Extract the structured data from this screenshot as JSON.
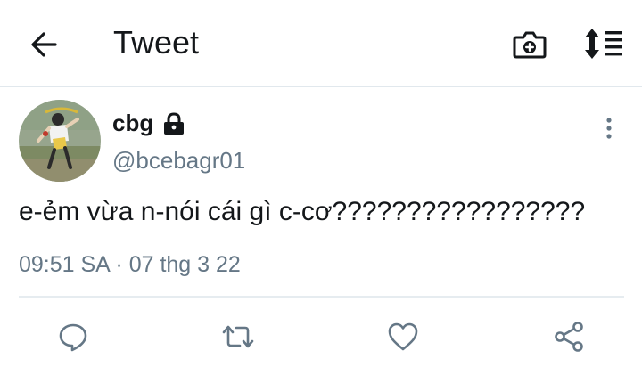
{
  "header": {
    "title": "Tweet",
    "icons": {
      "back": "arrow-left-icon",
      "camera": "camera-plus-icon",
      "sort": "sort-list-icon"
    }
  },
  "tweet": {
    "author": {
      "name": "cbg",
      "handle": "@bcebagr01",
      "protected": true
    },
    "text": "e-ẻm vừa n-nói cái gì c-cơ?????????????????",
    "timestamp": "09:51 SA · 07 thg 3 22"
  },
  "actions": {
    "icons": [
      "reply-icon",
      "retweet-icon",
      "like-icon",
      "share-icon"
    ],
    "icon_color": "#657786"
  },
  "colors": {
    "text": "#14171a",
    "secondary": "#657786",
    "divider": "#e6ecf0"
  }
}
